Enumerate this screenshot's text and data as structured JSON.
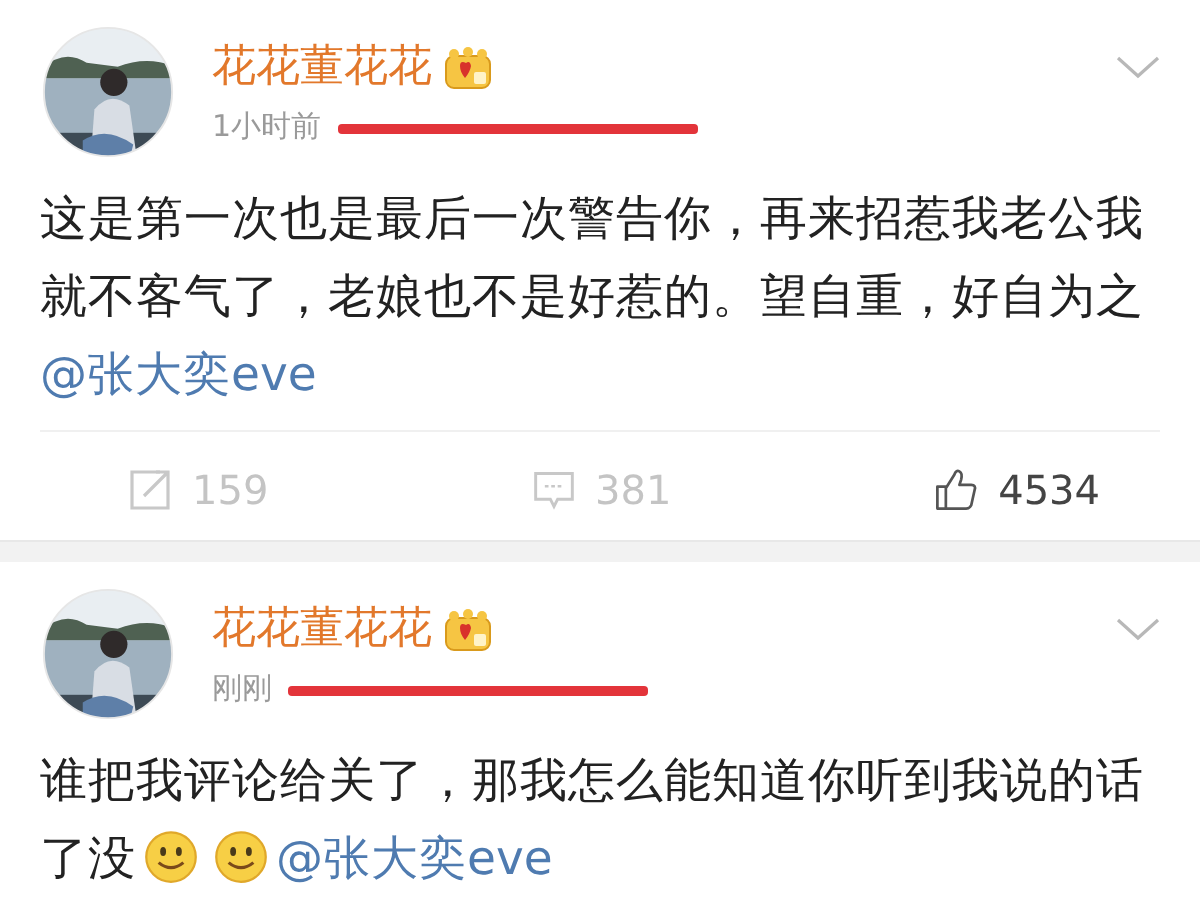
{
  "posts": [
    {
      "author": "花花董花花",
      "time": "1小时前",
      "source_redacted": true,
      "body": [
        {
          "kind": "text",
          "text": "这是第一次也是最后一次警告你，再来招惹我老公我就不客气了，老娘也不是好惹的。望自重，好自为之"
        },
        {
          "kind": "mention",
          "text": "@张大奕eve"
        }
      ],
      "actions": [
        {
          "kind": "repost",
          "count": "159"
        },
        {
          "kind": "comment",
          "count": "381"
        },
        {
          "kind": "like",
          "count": "4534"
        }
      ]
    },
    {
      "author": "花花董花花",
      "time": "刚刚",
      "source_redacted": true,
      "body": [
        {
          "kind": "text",
          "text": "谁把我评论给关了，那我怎么能知道你听到我说的话了没"
        },
        {
          "kind": "emoji"
        },
        {
          "kind": "emoji"
        },
        {
          "kind": "mention",
          "text": "@张大奕eve"
        }
      ]
    }
  ]
}
